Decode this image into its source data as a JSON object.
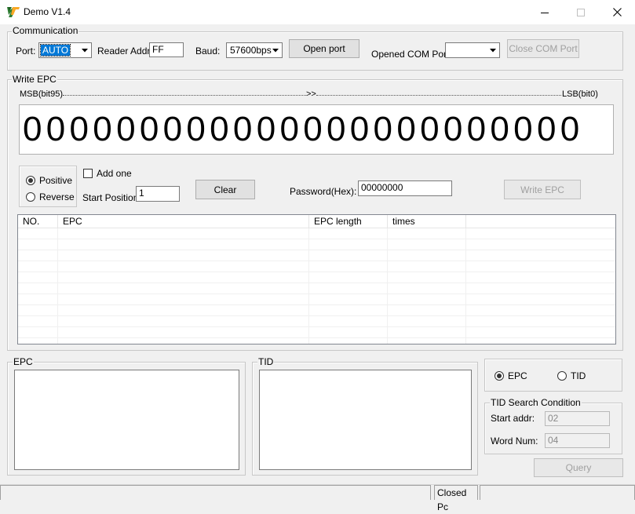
{
  "window": {
    "title": "Demo V1.4",
    "controls": {
      "minimize": "minimize-icon",
      "maximize": "maximize-icon",
      "close": "close-icon"
    }
  },
  "communication": {
    "legend": "Communication",
    "port_label": "Port:",
    "port_value": "AUTO",
    "reader_addr_label": "Reader Addr:",
    "reader_addr_value": "FF",
    "baud_label": "Baud:",
    "baud_value": "57600bps",
    "open_port_label": "Open port",
    "opened_com_label": "Opened COM Port:",
    "opened_com_value": "",
    "close_com_label": "Close COM Port"
  },
  "write_epc": {
    "legend": "Write EPC",
    "msb_label": "MSB(bit95)",
    "arrow": ">>",
    "lsb_label": "LSB(bit0)",
    "digits": "000000000000000000000000",
    "positive_label": "Positive",
    "reverse_label": "Reverse",
    "direction": "Positive",
    "add_one_label": "Add one",
    "add_one_checked": false,
    "start_position_label": "Start Position:",
    "start_position_value": "1",
    "clear_label": "Clear",
    "password_label": "Password(Hex):",
    "password_value": "00000000",
    "write_epc_label": "Write EPC"
  },
  "table": {
    "columns": [
      "NO.",
      "EPC",
      "EPC length",
      "times"
    ],
    "rows": []
  },
  "epc_panel": {
    "legend": "EPC",
    "content": ""
  },
  "tid_panel": {
    "legend": "TID",
    "content": ""
  },
  "mode": {
    "epc_label": "EPC",
    "tid_label": "TID",
    "selected": "EPC"
  },
  "tid_search": {
    "legend": "TID Search Condition",
    "start_addr_label": "Start addr:",
    "start_addr_value": "02",
    "word_num_label": "Word Num:",
    "word_num_value": "04",
    "query_label": "Query"
  },
  "status_bar": {
    "status_text": "Closed Pc"
  }
}
